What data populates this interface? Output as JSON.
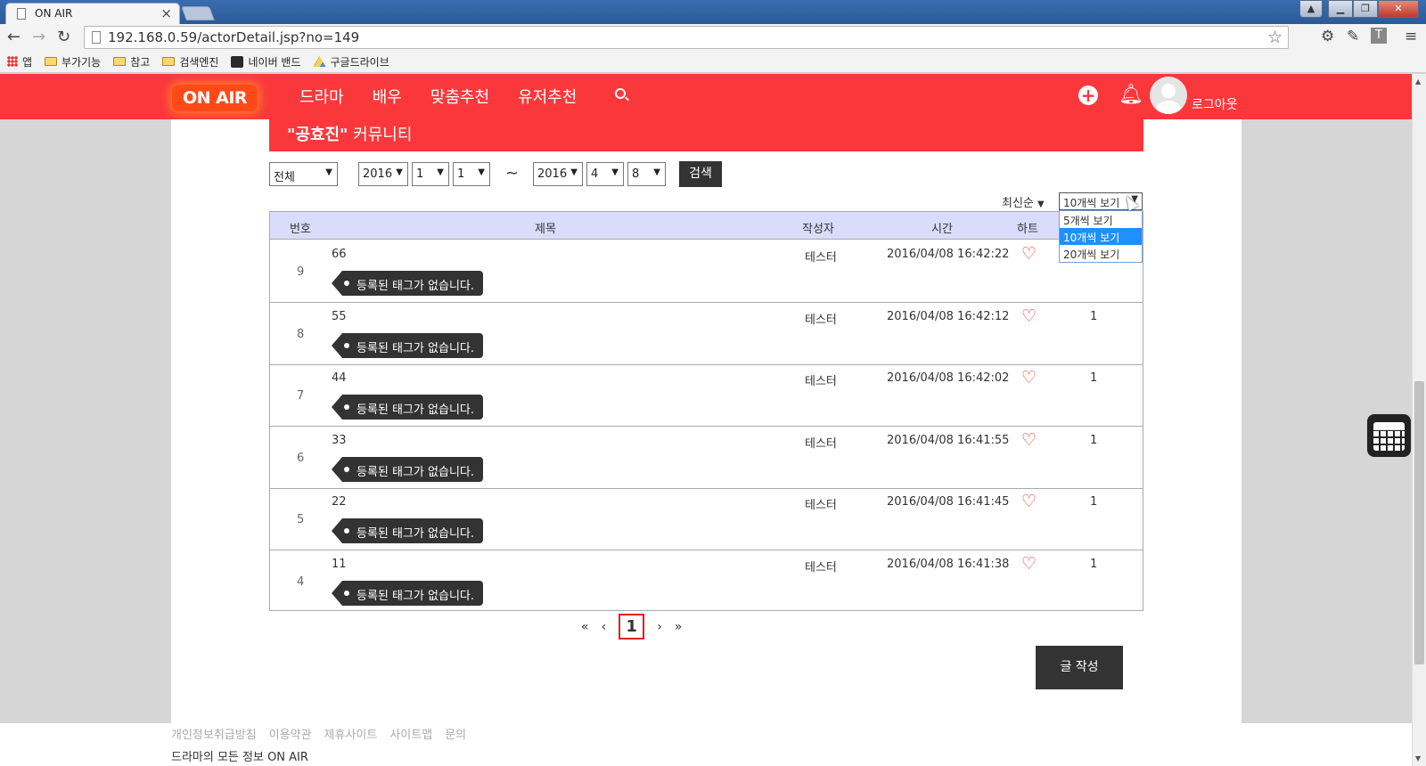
{
  "browser": {
    "tab_title": "ON AIR",
    "url": "192.168.0.59/actorDetail.jsp?no=149",
    "bookmarks": [
      "앱",
      "부가기능",
      "참고",
      "검색엔진",
      "네이버 밴드",
      "구글드라이브"
    ]
  },
  "site": {
    "logo": "ON AIR",
    "nav": [
      "드라마",
      "배우",
      "맞춤추천",
      "유저추천"
    ],
    "logout": "로그아웃"
  },
  "community": {
    "name": "\"공효진\"",
    "suffix": " 커뮤니티"
  },
  "filters": {
    "category": "전체",
    "start_year": "2016",
    "start_month": "1",
    "start_day": "1",
    "separator": "~",
    "end_year": "2016",
    "end_month": "4",
    "end_day": "8",
    "search_label": "검색"
  },
  "sorting": {
    "sort_label": "최신순",
    "per_page_selected": "10개씩 보기",
    "per_page_options": [
      "5개씩 보기",
      "10개씩 보기",
      "20개씩 보기"
    ]
  },
  "table": {
    "headers": [
      "번호",
      "제목",
      "작성자",
      "시간",
      "하트"
    ],
    "rows": [
      {
        "no": "9",
        "title": "66",
        "tag": "등록된 태그가 없습니다.",
        "author": "테스터",
        "time": "2016/04/08 16:42:22",
        "count": ""
      },
      {
        "no": "8",
        "title": "55",
        "tag": "등록된 태그가 없습니다.",
        "author": "테스터",
        "time": "2016/04/08 16:42:12",
        "count": "1"
      },
      {
        "no": "7",
        "title": "44",
        "tag": "등록된 태그가 없습니다.",
        "author": "테스터",
        "time": "2016/04/08 16:42:02",
        "count": "1"
      },
      {
        "no": "6",
        "title": "33",
        "tag": "등록된 태그가 없습니다.",
        "author": "테스터",
        "time": "2016/04/08 16:41:55",
        "count": "1"
      },
      {
        "no": "5",
        "title": "22",
        "tag": "등록된 태그가 없습니다.",
        "author": "테스터",
        "time": "2016/04/08 16:41:45",
        "count": "1"
      },
      {
        "no": "4",
        "title": "11",
        "tag": "등록된 태그가 없습니다.",
        "author": "테스터",
        "time": "2016/04/08 16:41:38",
        "count": "1"
      }
    ]
  },
  "pagination": {
    "first": "«",
    "prev": "‹",
    "current": "1",
    "next": "›",
    "last": "»"
  },
  "write_label": "글 작성",
  "footer": {
    "links": [
      "개인정보취급방침",
      "이용약관",
      "제휴사이트",
      "사이트맵",
      "문의"
    ],
    "copyright": "드라마의 모든 정보 ON AIR"
  },
  "colors": {
    "brand_red": "#fa383c",
    "header_row": "#d9dcfb",
    "dark_button": "#333333"
  }
}
